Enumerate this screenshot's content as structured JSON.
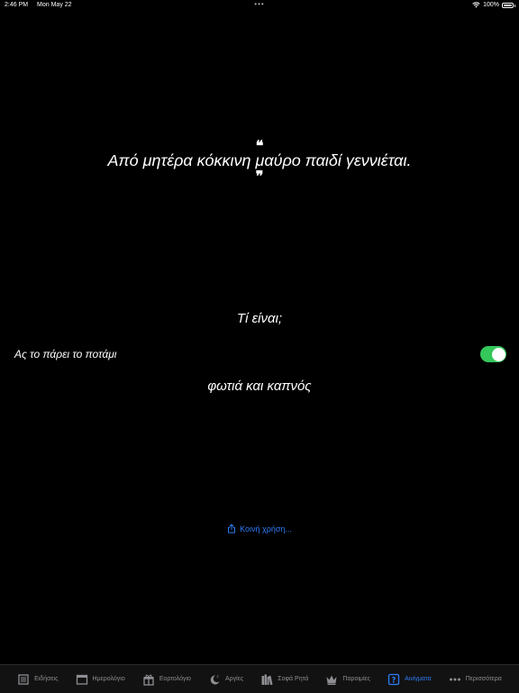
{
  "status_bar": {
    "time": "2:46 PM",
    "date": "Mon May 22",
    "battery": "100%"
  },
  "riddle": {
    "quote_open": "❝",
    "text": "Από μητέρα κόκκινη μαύρο παιδί γεννιέται.",
    "quote_close": "❞",
    "question": "Τί είναι;",
    "toggle_label": "Ας το πάρει το ποτάμι",
    "toggle_on": true,
    "answer": "φωτιά και καπνός",
    "share_label": "Κοινή χρήση..."
  },
  "tabs": [
    {
      "label": "Ειδήσεις",
      "icon": "newspaper-icon"
    },
    {
      "label": "Ημερολόγιο",
      "icon": "calendar-icon"
    },
    {
      "label": "Εορτολόγιο",
      "icon": "gift-icon"
    },
    {
      "label": "Αργίες",
      "icon": "moon-icon"
    },
    {
      "label": "Σοφά Ρητά",
      "icon": "books-icon"
    },
    {
      "label": "Παροιμίες",
      "icon": "crown-icon"
    },
    {
      "label": "Αινίγματα",
      "icon": "question-icon",
      "active": true
    },
    {
      "label": "Περισσότερα",
      "icon": "more-icon"
    }
  ],
  "colors": {
    "accent": "#2f7cf6",
    "toggle_on": "#34c759",
    "background": "#000000",
    "tab_inactive": "#8e8e93"
  }
}
